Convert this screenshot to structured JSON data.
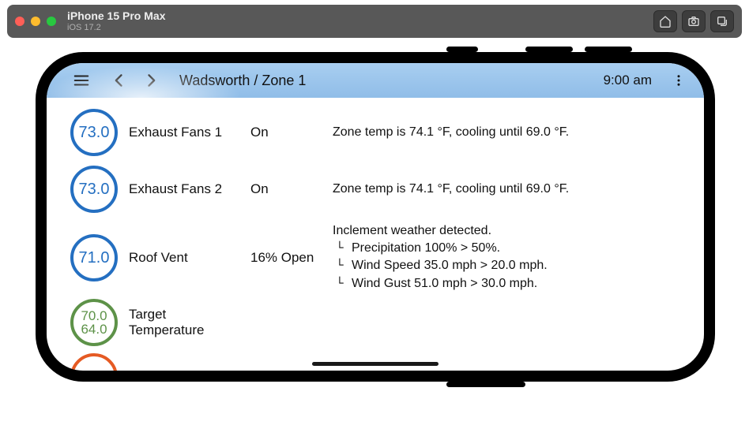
{
  "simulator": {
    "device_name": "iPhone 15 Pro Max",
    "os_version": "iOS 17.2"
  },
  "app": {
    "title": "Wadsworth / Zone 1",
    "time": "9:00 am"
  },
  "rows": [
    {
      "gauge_value": "73.0",
      "gauge_color": "blue",
      "label": "Exhaust Fans 1",
      "state": "On",
      "detail": "Zone temp is 74.1 °F, cooling until 69.0 °F."
    },
    {
      "gauge_value": "73.0",
      "gauge_color": "blue",
      "label": "Exhaust Fans 2",
      "state": "On",
      "detail": "Zone temp is 74.1 °F, cooling until 69.0 °F."
    },
    {
      "gauge_value": "71.0",
      "gauge_color": "blue",
      "label": "Roof Vent",
      "state": "16% Open",
      "detail_lines": [
        "Inclement weather detected.",
        "Precipitation 100% > 50%.",
        "Wind Speed 35.0 mph > 20.0 mph.",
        "Wind Gust 51.0 mph > 30.0 mph."
      ]
    },
    {
      "gauge_value_top": "70.0",
      "gauge_value_bottom": "64.0",
      "gauge_color": "green",
      "label_line1": "Target",
      "label_line2": "Temperature",
      "state": "",
      "detail": ""
    }
  ]
}
